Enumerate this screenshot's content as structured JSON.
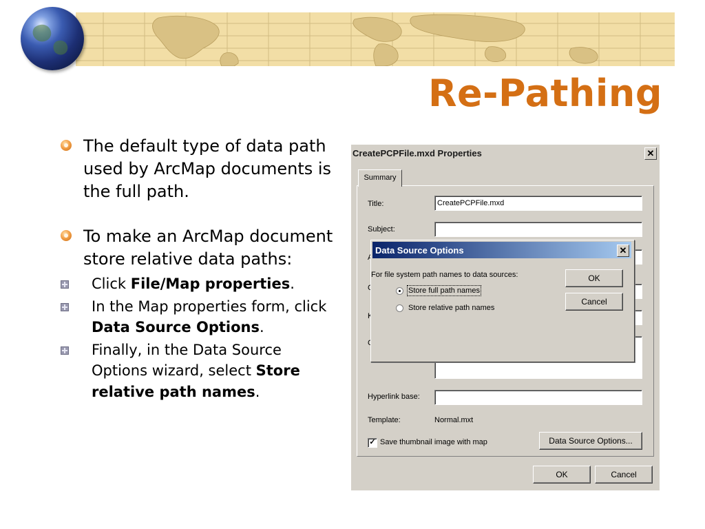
{
  "slide": {
    "title": "Re-Pathing",
    "bullets": [
      {
        "text": "The default type of data path used by ArcMap documents is the full path."
      },
      {
        "text": "To make an ArcMap document store relative data paths:"
      }
    ],
    "sub_bullets": [
      {
        "pre": "Click ",
        "bold": "File/Map properties",
        "post": "."
      },
      {
        "pre": "In the Map properties form, click ",
        "bold": "Data Source Options",
        "post": "."
      },
      {
        "pre": "Finally, in the Data Source Options wizard, select ",
        "bold": "Store relative path names",
        "post": "."
      }
    ],
    "colors": {
      "title": "#d46f14",
      "band": "#f2dea6",
      "bullet": "#f4a24a"
    }
  },
  "properties_dialog": {
    "title": "CreatePCPFile.mxd Properties",
    "close_glyph": "✕",
    "tab": "Summary",
    "title_label": "Title:",
    "title_value": "CreatePCPFile.mxd",
    "subject_label": "Subject:",
    "hyperlink_label": "Hyperlink base:",
    "template_label": "Template:",
    "template_value": "Normal.mxt",
    "thumbnail_label": "Save thumbnail image with map",
    "thumbnail_checked": true,
    "data_source_button": "Data Source Options...",
    "ok_button": "OK",
    "cancel_button": "Cancel",
    "clipped_label_initials": [
      "A",
      "C",
      "K",
      "C"
    ]
  },
  "data_source_dialog": {
    "title": "Data Source Options",
    "close_glyph": "✕",
    "description": "For file system path names to data sources:",
    "options": [
      {
        "label": "Store full path names",
        "selected": true
      },
      {
        "label": "Store relative path names",
        "selected": false
      }
    ],
    "ok_button": "OK",
    "cancel_button": "Cancel"
  }
}
